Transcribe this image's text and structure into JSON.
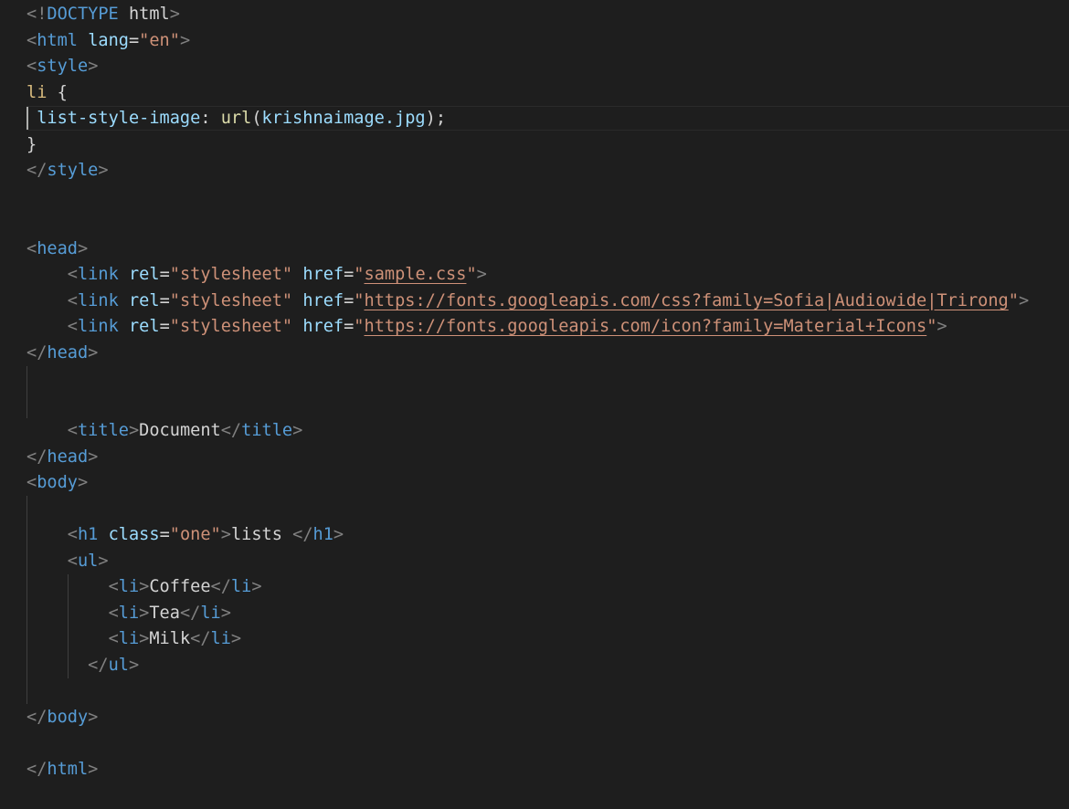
{
  "editor": {
    "lines": [
      {
        "indent": "",
        "tokens": [
          [
            "bracket",
            "<!"
          ],
          [
            "tag",
            "DOCTYPE"
          ],
          [
            "text",
            " html"
          ],
          [
            "bracket",
            ">"
          ]
        ]
      },
      {
        "indent": "",
        "tokens": [
          [
            "bracket",
            "<"
          ],
          [
            "tag",
            "html"
          ],
          [
            "text",
            " "
          ],
          [
            "attr",
            "lang"
          ],
          [
            "punct",
            "="
          ],
          [
            "str",
            "\"en\""
          ],
          [
            "bracket",
            ">"
          ]
        ]
      },
      {
        "indent": "",
        "tokens": [
          [
            "bracket",
            "<"
          ],
          [
            "tag",
            "style"
          ],
          [
            "bracket",
            ">"
          ]
        ]
      },
      {
        "indent": "",
        "tokens": [
          [
            "sel",
            "li"
          ],
          [
            "punct",
            " {"
          ]
        ]
      },
      {
        "indent": " ",
        "tokens": [
          [
            "prop",
            "list-style-image"
          ],
          [
            "punct",
            ": "
          ],
          [
            "fn",
            "url"
          ],
          [
            "punct",
            "("
          ],
          [
            "attr",
            "krishnaimage.jpg"
          ],
          [
            "punct",
            ");"
          ]
        ]
      },
      {
        "indent": "",
        "tokens": [
          [
            "punct",
            "}"
          ]
        ]
      },
      {
        "indent": "",
        "tokens": [
          [
            "bracket",
            "</"
          ],
          [
            "tag",
            "style"
          ],
          [
            "bracket",
            ">"
          ]
        ]
      },
      {
        "indent": "",
        "tokens": []
      },
      {
        "indent": "",
        "tokens": []
      },
      {
        "indent": "",
        "tokens": [
          [
            "bracket",
            "<"
          ],
          [
            "tag",
            "head"
          ],
          [
            "bracket",
            ">"
          ]
        ]
      },
      {
        "indent": "    ",
        "tokens": [
          [
            "bracket",
            "<"
          ],
          [
            "tag",
            "link"
          ],
          [
            "text",
            " "
          ],
          [
            "attr",
            "rel"
          ],
          [
            "punct",
            "="
          ],
          [
            "str",
            "\"stylesheet\""
          ],
          [
            "text",
            " "
          ],
          [
            "attr",
            "href"
          ],
          [
            "punct",
            "="
          ],
          [
            "str",
            "\""
          ],
          [
            "link",
            "sample.css"
          ],
          [
            "str",
            "\""
          ],
          [
            "bracket",
            ">"
          ]
        ]
      },
      {
        "indent": "    ",
        "tokens": [
          [
            "bracket",
            "<"
          ],
          [
            "tag",
            "link"
          ],
          [
            "text",
            " "
          ],
          [
            "attr",
            "rel"
          ],
          [
            "punct",
            "="
          ],
          [
            "str",
            "\"stylesheet\""
          ],
          [
            "text",
            " "
          ],
          [
            "attr",
            "href"
          ],
          [
            "punct",
            "="
          ],
          [
            "str",
            "\""
          ],
          [
            "link",
            "https://fonts.googleapis.com/css?family=Sofia|Audiowide|Trirong"
          ],
          [
            "str",
            "\""
          ],
          [
            "bracket",
            ">"
          ]
        ]
      },
      {
        "indent": "    ",
        "tokens": [
          [
            "bracket",
            "<"
          ],
          [
            "tag",
            "link"
          ],
          [
            "text",
            " "
          ],
          [
            "attr",
            "rel"
          ],
          [
            "punct",
            "="
          ],
          [
            "str",
            "\"stylesheet\""
          ],
          [
            "text",
            " "
          ],
          [
            "attr",
            "href"
          ],
          [
            "punct",
            "="
          ],
          [
            "str",
            "\""
          ],
          [
            "link",
            "https://fonts.googleapis.com/icon?family=Material+Icons"
          ],
          [
            "str",
            "\""
          ],
          [
            "bracket",
            ">"
          ]
        ]
      },
      {
        "indent": "",
        "tokens": [
          [
            "bracket",
            "</"
          ],
          [
            "tag",
            "head"
          ],
          [
            "bracket",
            ">"
          ]
        ]
      },
      {
        "indent": "",
        "tokens": []
      },
      {
        "indent": "",
        "tokens": []
      },
      {
        "indent": "    ",
        "tokens": [
          [
            "bracket",
            "<"
          ],
          [
            "tag",
            "title"
          ],
          [
            "bracket",
            ">"
          ],
          [
            "text",
            "Document"
          ],
          [
            "bracket",
            "</"
          ],
          [
            "tag",
            "title"
          ],
          [
            "bracket",
            ">"
          ]
        ]
      },
      {
        "indent": "",
        "tokens": [
          [
            "bracket",
            "</"
          ],
          [
            "tag",
            "head"
          ],
          [
            "bracket",
            ">"
          ]
        ]
      },
      {
        "indent": "",
        "tokens": [
          [
            "bracket",
            "<"
          ],
          [
            "tag",
            "body"
          ],
          [
            "bracket",
            ">"
          ]
        ]
      },
      {
        "indent": "",
        "tokens": []
      },
      {
        "indent": "    ",
        "tokens": [
          [
            "bracket",
            "<"
          ],
          [
            "tag",
            "h1"
          ],
          [
            "text",
            " "
          ],
          [
            "attr",
            "class"
          ],
          [
            "punct",
            "="
          ],
          [
            "str",
            "\"one\""
          ],
          [
            "bracket",
            ">"
          ],
          [
            "text",
            "lists "
          ],
          [
            "bracket",
            "</"
          ],
          [
            "tag",
            "h1"
          ],
          [
            "bracket",
            ">"
          ]
        ]
      },
      {
        "indent": "    ",
        "tokens": [
          [
            "bracket",
            "<"
          ],
          [
            "tag",
            "ul"
          ],
          [
            "bracket",
            ">"
          ]
        ]
      },
      {
        "indent": "        ",
        "tokens": [
          [
            "bracket",
            "<"
          ],
          [
            "tag",
            "li"
          ],
          [
            "bracket",
            ">"
          ],
          [
            "text",
            "Coffee"
          ],
          [
            "bracket",
            "</"
          ],
          [
            "tag",
            "li"
          ],
          [
            "bracket",
            ">"
          ]
        ]
      },
      {
        "indent": "        ",
        "tokens": [
          [
            "bracket",
            "<"
          ],
          [
            "tag",
            "li"
          ],
          [
            "bracket",
            ">"
          ],
          [
            "text",
            "Tea"
          ],
          [
            "bracket",
            "</"
          ],
          [
            "tag",
            "li"
          ],
          [
            "bracket",
            ">"
          ]
        ]
      },
      {
        "indent": "        ",
        "tokens": [
          [
            "bracket",
            "<"
          ],
          [
            "tag",
            "li"
          ],
          [
            "bracket",
            ">"
          ],
          [
            "text",
            "Milk"
          ],
          [
            "bracket",
            "</"
          ],
          [
            "tag",
            "li"
          ],
          [
            "bracket",
            ">"
          ]
        ]
      },
      {
        "indent": "      ",
        "tokens": [
          [
            "bracket",
            "</"
          ],
          [
            "tag",
            "ul"
          ],
          [
            "bracket",
            ">"
          ]
        ]
      },
      {
        "indent": "",
        "tokens": []
      },
      {
        "indent": "",
        "tokens": [
          [
            "bracket",
            "</"
          ],
          [
            "tag",
            "body"
          ],
          [
            "bracket",
            ">"
          ]
        ]
      },
      {
        "indent": "",
        "tokens": []
      },
      {
        "indent": "",
        "tokens": [
          [
            "bracket",
            "</"
          ],
          [
            "tag",
            "html"
          ],
          [
            "bracket",
            ">"
          ]
        ]
      }
    ]
  },
  "colors": {
    "background": "#1e1e1e",
    "bracket": "#808080",
    "tag": "#569cd6",
    "attribute": "#9cdcfe",
    "string": "#ce9178",
    "text": "#d4d4d4",
    "selector": "#d7ba7d",
    "function": "#dcdcaa"
  }
}
